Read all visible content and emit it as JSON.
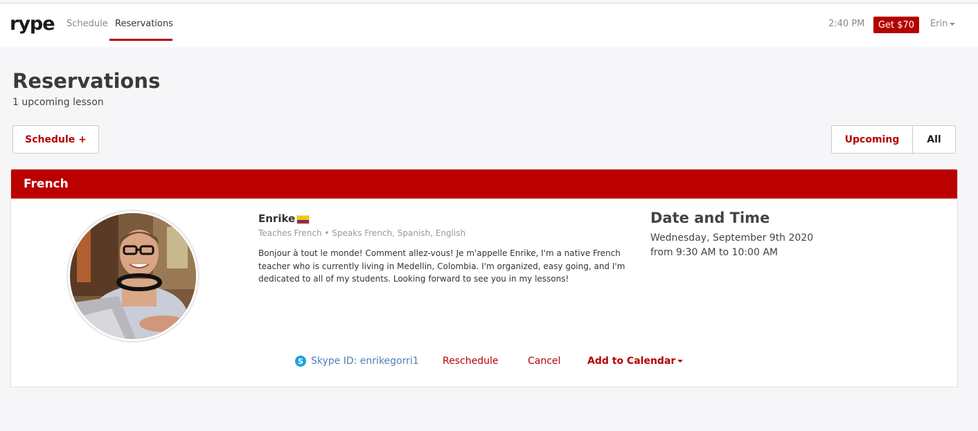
{
  "nav": {
    "logo": "rype",
    "links": [
      "Schedule",
      "Reservations"
    ],
    "active": "Reservations",
    "time": "2:40 PM",
    "cta_label": "Get $70",
    "user_name": "Erin"
  },
  "page": {
    "title": "Reservations",
    "subtitle": "1 upcoming lesson",
    "schedule_button": "Schedule +",
    "filters": [
      "Upcoming",
      "All"
    ],
    "active_filter": "Upcoming"
  },
  "lesson": {
    "language": "French",
    "teacher": {
      "name": "Enrike",
      "country_flag": "colombia-flag-icon",
      "meta": "Teaches French • Speaks French, Spanish, English",
      "bio": "Bonjour à tout le monde! Comment allez-vous! Je m'appelle Enrike, I'm a native French teacher who is currently living in Medellin, Colombia. I'm organized, easy going, and I'm dedicated to all of my students. Looking forward to see you in my lessons!"
    },
    "date_time": {
      "title": "Date and Time",
      "date": "Wednesday, September 9th 2020",
      "time": "from 9:30 AM to 10:00 AM"
    },
    "actions": {
      "skype": "Skype ID: enrikegorri1",
      "reschedule": "Reschedule",
      "cancel": "Cancel",
      "add_to_calendar": "Add to Calendar"
    }
  },
  "colors": {
    "brand_red": "#b50000",
    "header_red": "#bb0000",
    "link_blue": "#4a80b8"
  }
}
